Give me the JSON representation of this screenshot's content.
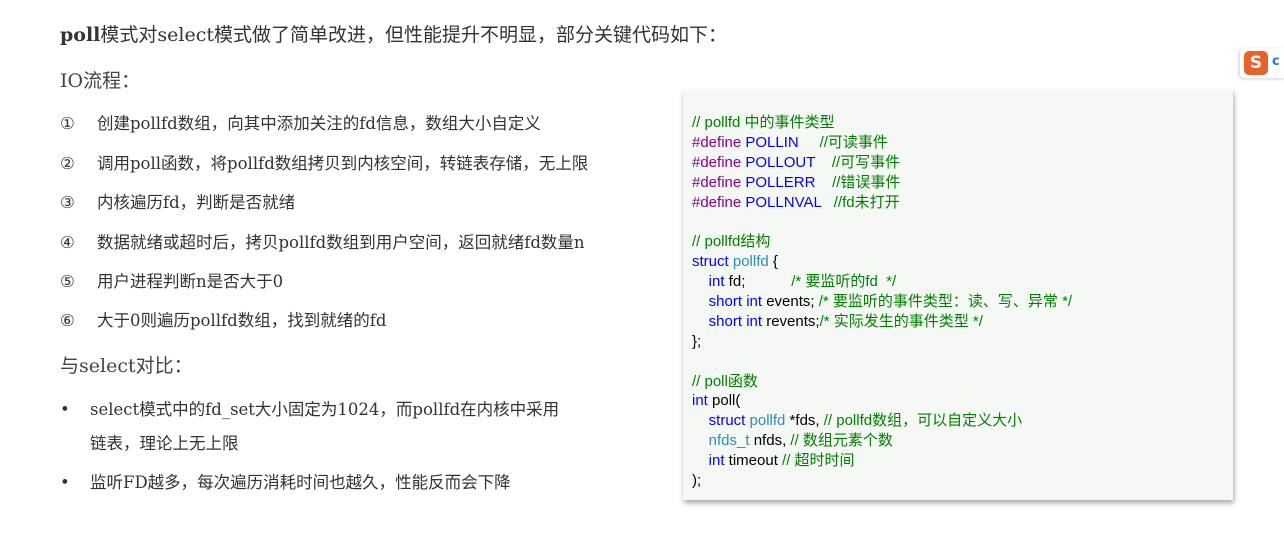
{
  "intro": {
    "keyword": "poll",
    "text": "模式对select模式做了简单改进，但性能提升不明显，部分关键代码如下："
  },
  "io_heading": "IO流程：",
  "steps": [
    {
      "num": "①",
      "text": "创建pollfd数组，向其中添加关注的fd信息，数组大小自定义"
    },
    {
      "num": "②",
      "text": "调用poll函数，将pollfd数组拷贝到内核空间，转链表存储，无上限"
    },
    {
      "num": "③",
      "text": "内核遍历fd，判断是否就绪"
    },
    {
      "num": "④",
      "text": "数据就绪或超时后，拷贝pollfd数组到用户空间，返回就绪fd数量n"
    },
    {
      "num": "⑤",
      "text": "用户进程判断n是否大于0"
    },
    {
      "num": "⑥",
      "text": "大于0则遍历pollfd数组，找到就绪的fd"
    }
  ],
  "compare_heading": "与select对比：",
  "bullets": [
    {
      "dot": "•",
      "text": "select模式中的fd_set大小固定为1024，而pollfd在内核中采用",
      "cont": "链表，理论上无上限"
    },
    {
      "dot": "•",
      "text": "监听FD越多，每次遍历消耗时间也越久，性能反而会下降"
    }
  ],
  "code": {
    "background": "#f6f8f5",
    "colors": {
      "comment": "#008000",
      "keyword": "#0000ff",
      "directive": "#8b008b",
      "type": "#2b91af",
      "plain": "#000000"
    },
    "lines": [
      [
        {
          "t": "// pollfd 中的事件类型",
          "k": "comment"
        }
      ],
      [
        {
          "t": "#define",
          "k": "directive"
        },
        {
          "t": " POLLIN     ",
          "k": "keyword"
        },
        {
          "t": "//可读事件",
          "k": "comment"
        }
      ],
      [
        {
          "t": "#define",
          "k": "directive"
        },
        {
          "t": " POLLOUT    ",
          "k": "keyword"
        },
        {
          "t": "//可写事件",
          "k": "comment"
        }
      ],
      [
        {
          "t": "#define",
          "k": "directive"
        },
        {
          "t": " POLLERR    ",
          "k": "keyword"
        },
        {
          "t": "//错误事件",
          "k": "comment"
        }
      ],
      [
        {
          "t": "#define",
          "k": "directive"
        },
        {
          "t": " POLLNVAL   ",
          "k": "keyword"
        },
        {
          "t": "//fd未打开",
          "k": "comment"
        }
      ],
      [],
      [
        {
          "t": "// pollfd结构",
          "k": "comment"
        }
      ],
      [
        {
          "t": "struct",
          "k": "keyword"
        },
        {
          "t": " pollfd",
          "k": "type"
        },
        {
          "t": " {",
          "k": "plain"
        }
      ],
      [
        {
          "t": "    ",
          "k": "plain"
        },
        {
          "t": "int",
          "k": "keyword"
        },
        {
          "t": " fd;           ",
          "k": "plain"
        },
        {
          "t": "/* 要监听的fd  */",
          "k": "comment"
        }
      ],
      [
        {
          "t": "    ",
          "k": "plain"
        },
        {
          "t": "short",
          "k": "keyword"
        },
        {
          "t": " ",
          "k": "plain"
        },
        {
          "t": "int",
          "k": "keyword"
        },
        {
          "t": " events; ",
          "k": "plain"
        },
        {
          "t": "/* 要监听的事件类型：读、写、异常 */",
          "k": "comment"
        }
      ],
      [
        {
          "t": "    ",
          "k": "plain"
        },
        {
          "t": "short",
          "k": "keyword"
        },
        {
          "t": " ",
          "k": "plain"
        },
        {
          "t": "int",
          "k": "keyword"
        },
        {
          "t": " revents;",
          "k": "plain"
        },
        {
          "t": "/* 实际发生的事件类型 */",
          "k": "comment"
        }
      ],
      [
        {
          "t": "};",
          "k": "plain"
        }
      ],
      [],
      [
        {
          "t": "// poll函数",
          "k": "comment"
        }
      ],
      [
        {
          "t": "int",
          "k": "keyword"
        },
        {
          "t": " poll(",
          "k": "plain"
        }
      ],
      [
        {
          "t": "    ",
          "k": "plain"
        },
        {
          "t": "struct",
          "k": "keyword"
        },
        {
          "t": " pollfd",
          "k": "type"
        },
        {
          "t": " *fds, ",
          "k": "plain"
        },
        {
          "t": "// pollfd数组，可以自定义大小",
          "k": "comment"
        }
      ],
      [
        {
          "t": "    ",
          "k": "plain"
        },
        {
          "t": "nfds_t",
          "k": "type"
        },
        {
          "t": " nfds, ",
          "k": "plain"
        },
        {
          "t": "// 数组元素个数",
          "k": "comment"
        }
      ],
      [
        {
          "t": "    ",
          "k": "plain"
        },
        {
          "t": "int",
          "k": "keyword"
        },
        {
          "t": " timeout ",
          "k": "plain"
        },
        {
          "t": "// 超时时间",
          "k": "comment"
        }
      ],
      [
        {
          "t": ");",
          "k": "plain"
        }
      ]
    ]
  },
  "logo": {
    "icon": "S",
    "text": "c"
  }
}
